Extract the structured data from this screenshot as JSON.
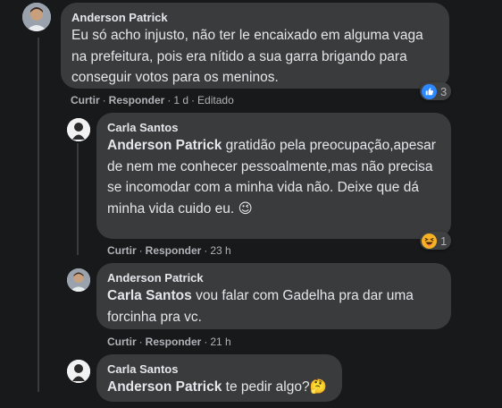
{
  "comments": [
    {
      "author": "Anderson Patrick",
      "text": "Eu só acho injusto, não ter le encaixado em alguma vaga na prefeitura, pois era nítido a sua garra brigando para conseguir votos para os meninos.",
      "actions": {
        "like": "Curtir",
        "reply": "Responder",
        "time": "1 d",
        "edited": "Editado"
      },
      "reaction": {
        "icon": "like-icon",
        "count": "3",
        "color": "#2d88ff"
      }
    },
    {
      "author": "Carla Santos",
      "mention": "Anderson Patrick",
      "text": " gratidão pela preocupação,apesar de nem me conhecer pessoalmente,mas não precisa se incomodar com a minha vida não. Deixe que dá minha vida cuido eu. ",
      "emoji": "😉",
      "actions": {
        "like": "Curtir",
        "reply": "Responder",
        "time": "23 h"
      },
      "reaction": {
        "icon": "haha-icon",
        "count": "1"
      }
    },
    {
      "author": "Anderson Patrick",
      "mention": "Carla Santos",
      "text": " vou falar com Gadelha pra dar uma forcinha pra vc.",
      "actions": {
        "like": "Curtir",
        "reply": "Responder",
        "time": "21 h"
      }
    },
    {
      "author": "Carla Santos",
      "mention": "Anderson Patrick",
      "text": " te pedir algo?",
      "emoji": "🤔"
    }
  ],
  "theme": {
    "background": "#18191a",
    "bubble": "#3a3b3c",
    "text": "#e4e6eb",
    "secondary_text": "#b0b3b8"
  }
}
